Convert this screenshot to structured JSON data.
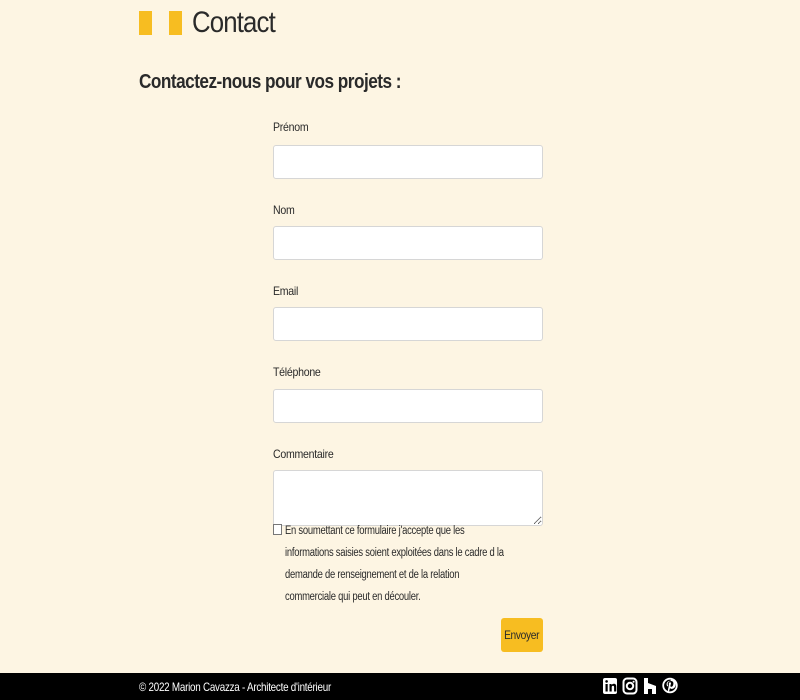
{
  "page": {
    "title": "Contact",
    "intro": "Contactez-nous pour vos projets :"
  },
  "form": {
    "fields": [
      {
        "label": "Prénom",
        "value": "",
        "placeholder": ""
      },
      {
        "label": "Nom",
        "value": "",
        "placeholder": ""
      },
      {
        "label": "Email",
        "value": "",
        "placeholder": ""
      },
      {
        "label": "Téléphone",
        "value": "",
        "placeholder": ""
      },
      {
        "label": "Commentaire",
        "value": "",
        "placeholder": ""
      }
    ],
    "consent": {
      "checked": false,
      "text": "En soumettant ce formulaire j'accepte que les informations saisies soient exploitées dans le cadre d la demande de renseignement et de la relation commerciale qui peut en découler."
    },
    "submit_label": "Envoyer"
  },
  "footer": {
    "copyright": "© 2022 Marion Cavazza - Architecte d'intérieur",
    "socials": [
      "linkedin-icon",
      "instagram-icon",
      "houzz-icon",
      "pinterest-icon"
    ]
  },
  "colors": {
    "background": "#fdf5e3",
    "accent": "#f7bd21",
    "footer": "#000000"
  }
}
